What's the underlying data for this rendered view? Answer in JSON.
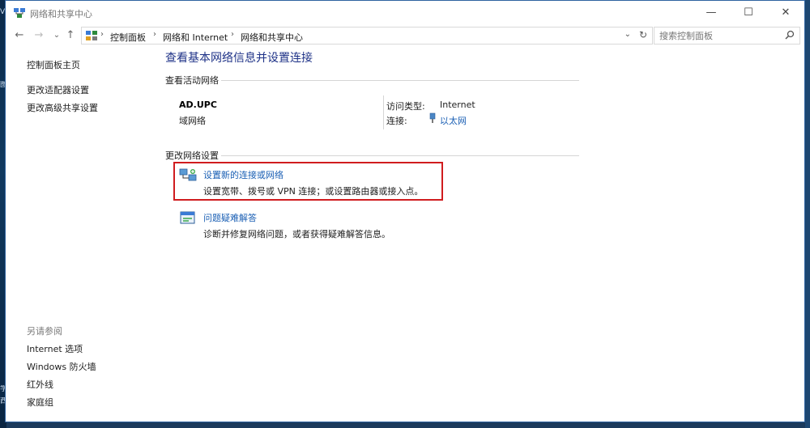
{
  "window": {
    "title": "网络和共享中心",
    "controls": {
      "minimize": "—",
      "maximize": "☐",
      "close": "✕"
    }
  },
  "navigation": {
    "back": "←",
    "forward": "→",
    "recent": "⌄",
    "up": "↑",
    "breadcrumbs": [
      "控制面板",
      "网络和 Internet",
      "网络和共享中心"
    ],
    "separator": "›",
    "dropdown": "⌄",
    "refresh": "↻"
  },
  "search": {
    "placeholder": "搜索控制面板",
    "value": ""
  },
  "sidebar": {
    "home": "控制面板主页",
    "links": [
      "更改适配器设置",
      "更改高级共享设置"
    ],
    "see_also_heading": "另请参阅",
    "see_also": [
      "Internet 选项",
      "Windows 防火墙",
      "红外线",
      "家庭组"
    ]
  },
  "main": {
    "title": "查看基本网络信息并设置连接",
    "active_networks_label": "查看活动网络",
    "network": {
      "name": "AD.UPC",
      "category": "域网络",
      "access_type_label": "访问类型:",
      "access_type_value": "Internet",
      "connections_label": "连接:",
      "connection_link": "以太网"
    },
    "change_settings_label": "更改网络设置",
    "tasks": [
      {
        "title": "设置新的连接或网络",
        "description": "设置宽带、拨号或 VPN 连接；或设置路由器或接入点。",
        "icon": "network-setup-icon"
      },
      {
        "title": "问题疑难解答",
        "description": "诊断并修复网络问题，或者获得疑难解答信息。",
        "icon": "troubleshoot-icon"
      }
    ]
  },
  "desktop": {
    "edge_glyphs": [
      "V",
      "图",
      "学",
      "西"
    ]
  },
  "colors": {
    "link": "#1a5fb4",
    "title": "#1e3287",
    "highlight_border": "#d01c1f"
  }
}
